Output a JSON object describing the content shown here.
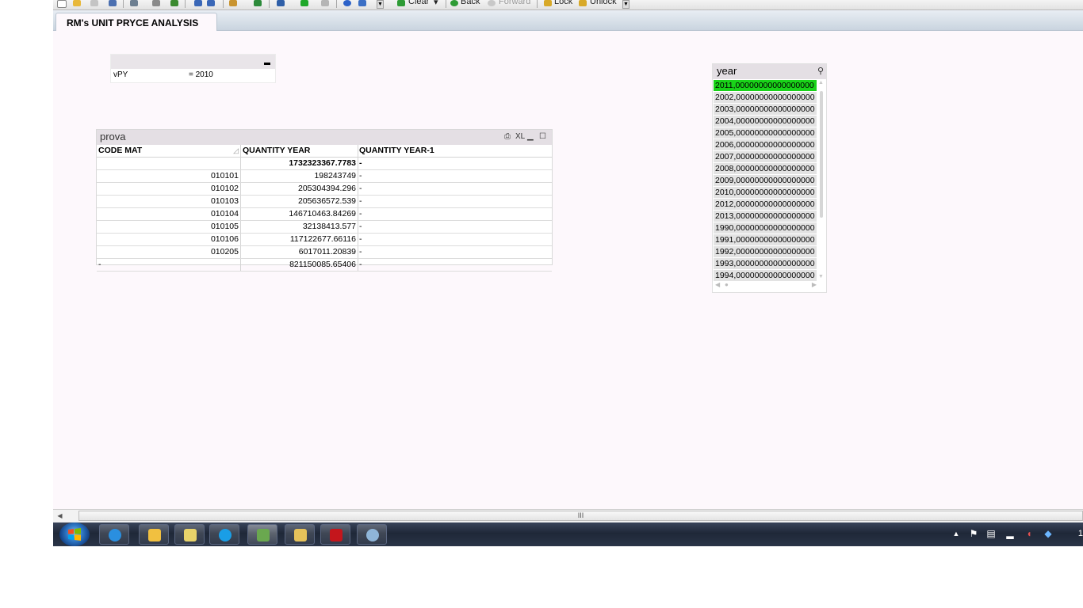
{
  "toolbar": {
    "clear_label": "Clear",
    "back_label": "Back",
    "forward_label": "Forward",
    "lock_label": "Lock",
    "unlock_label": "Unlock"
  },
  "sheet_tab": {
    "label": "RM's UNIT PRYCE ANALYSIS"
  },
  "input_box": {
    "variable": "vPY",
    "value": "= 2010"
  },
  "table": {
    "title": "prova",
    "xl_label": "XL",
    "headers": [
      "CODE MAT",
      "QUANTITY YEAR",
      "QUANTITY YEAR-1"
    ],
    "total": {
      "code": "",
      "qty": "1732323367.7783",
      "qty_prev": "-"
    },
    "rows": [
      {
        "code": "010101",
        "qty": "198243749",
        "qty_prev": "-"
      },
      {
        "code": "010102",
        "qty": "205304394.296",
        "qty_prev": "-"
      },
      {
        "code": "010103",
        "qty": "205636572.539",
        "qty_prev": "-"
      },
      {
        "code": "010104",
        "qty": "146710463.84269",
        "qty_prev": "-"
      },
      {
        "code": "010105",
        "qty": "32138413.577",
        "qty_prev": "-"
      },
      {
        "code": "010106",
        "qty": "117122677.66116",
        "qty_prev": "-"
      },
      {
        "code": "010205",
        "qty": "6017011.20839",
        "qty_prev": "-"
      },
      {
        "code": "-",
        "qty": "821150085.65406",
        "qty_prev": "-"
      }
    ]
  },
  "listbox": {
    "title": "year",
    "selected_color": "#19d319",
    "items": [
      "2011,00000000000000000",
      "2002,00000000000000000",
      "2003,00000000000000000",
      "2004,00000000000000000",
      "2005,00000000000000000",
      "2006,00000000000000000",
      "2007,00000000000000000",
      "2008,00000000000000000",
      "2009,00000000000000000",
      "2010,00000000000000000",
      "2012,00000000000000000",
      "2013,00000000000000000",
      "1990,00000000000000000",
      "1991,00000000000000000",
      "1992,00000000000000000",
      "1993,00000000000000000",
      "1994,00000000000000000"
    ]
  },
  "scrollbar": {
    "grip": "III"
  },
  "taskbar": {
    "icons": [
      "start-orb-icon",
      "internet-explorer-icon",
      "outlook-icon",
      "file-transfer-icon",
      "skype-icon",
      "qlikview-icon",
      "file-explorer-icon",
      "acrobat-icon",
      "paint-icon"
    ],
    "clock": "1"
  }
}
